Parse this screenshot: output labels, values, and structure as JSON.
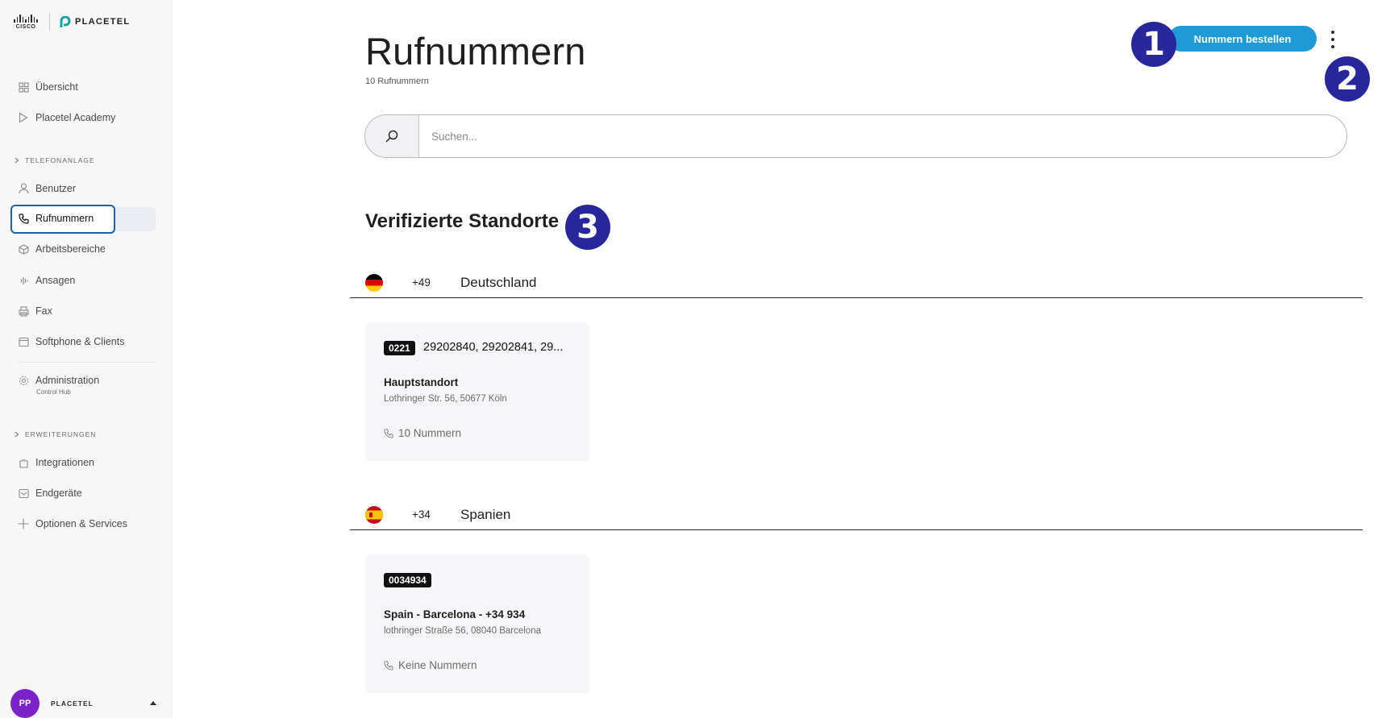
{
  "brand": {
    "cisco": "CISCO",
    "placetel": "PLACETEL"
  },
  "sidebar": {
    "items": [
      {
        "label": "Übersicht",
        "icon": "grid-icon"
      },
      {
        "label": "Placetel Academy",
        "icon": "play-icon"
      },
      {
        "label": "Benutzer",
        "icon": "user-icon"
      },
      {
        "label": "Rufnummern",
        "icon": "phone-icon"
      },
      {
        "label": "Arbeitsbereiche",
        "icon": "cube-icon"
      },
      {
        "label": "Ansagen",
        "icon": "waveform-icon"
      },
      {
        "label": "Fax",
        "icon": "printer-icon"
      },
      {
        "label": "Softphone & Clients",
        "icon": "window-icon"
      },
      {
        "label": "Administration",
        "sublabel": "Control Hub",
        "icon": "gear-icon"
      },
      {
        "label": "Integrationen",
        "icon": "puzzle-icon"
      },
      {
        "label": "Endgeräte",
        "icon": "device-icon"
      },
      {
        "label": "Optionen & Services",
        "icon": "plus-icon"
      }
    ],
    "sections": {
      "telefonanlage": "TELEFONANLAGE",
      "erweiterungen": "ERWEITERUNGEN"
    },
    "active": "Rufnummern",
    "user": {
      "initials": "PP",
      "name": "PLACETEL",
      "avatar_color": "#7b22c9"
    }
  },
  "header": {
    "title": "Rufnummern",
    "subtitle": "10 Rufnummern",
    "order_button": "Nummern bestellen",
    "accent_color": "#1e9ad6"
  },
  "annotations": [
    "1",
    "2",
    "3"
  ],
  "search": {
    "placeholder": "Suchen..."
  },
  "section_title": "Verifizierte Standorte",
  "locations": [
    {
      "dial": "+49",
      "country": "Deutschland",
      "prefix": "0221",
      "numbers": "29202840, 29202841, 29...",
      "name": "Hauptstandort",
      "address": "Lothringer Str. 56, 50677 Köln",
      "count": "10 Nummern"
    },
    {
      "dial": "+34",
      "country": "Spanien",
      "prefix": "0034934",
      "numbers": "",
      "name": "Spain - Barcelona - +34 934",
      "address": "lothringer Straße 56, 08040 Barcelona",
      "count": "Keine Nummern"
    }
  ]
}
